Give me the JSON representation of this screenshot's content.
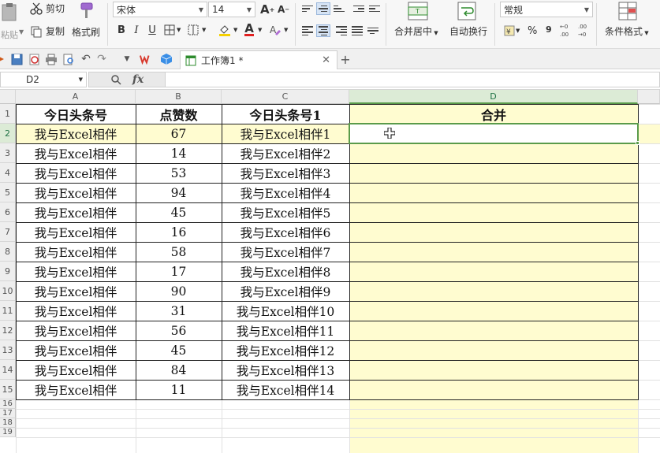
{
  "ribbon": {
    "paste": "粘贴",
    "cut": "剪切",
    "copy": "复制",
    "format_painter": "格式刷",
    "font_name": "宋体",
    "font_size": "14",
    "merge_center": "合并居中",
    "wrap_text": "自动换行",
    "number_format": "常规",
    "percent": "%",
    "thousands": "9",
    "conditional_format": "条件格式",
    "bold": "B",
    "italic": "I",
    "underline": "U"
  },
  "quick_access": {
    "doc_tab": "工作簿1 *"
  },
  "formula_bar": {
    "cell_ref": "D2",
    "fx_label": "fx",
    "value": ""
  },
  "grid": {
    "columns": [
      "A",
      "B",
      "C",
      "D"
    ],
    "row_numbers": [
      "1",
      "2",
      "3",
      "4",
      "5",
      "6",
      "7",
      "8",
      "9",
      "10",
      "11",
      "12",
      "13",
      "14",
      "15",
      "16",
      "17",
      "18",
      "19"
    ],
    "headers": [
      "今日头条号",
      "点赞数",
      "今日头条号1",
      "合并"
    ],
    "rows": [
      [
        "我与Excel相伴",
        "67",
        "我与Excel相伴1",
        ""
      ],
      [
        "我与Excel相伴",
        "14",
        "我与Excel相伴2",
        ""
      ],
      [
        "我与Excel相伴",
        "53",
        "我与Excel相伴3",
        ""
      ],
      [
        "我与Excel相伴",
        "94",
        "我与Excel相伴4",
        ""
      ],
      [
        "我与Excel相伴",
        "45",
        "我与Excel相伴5",
        ""
      ],
      [
        "我与Excel相伴",
        "16",
        "我与Excel相伴6",
        ""
      ],
      [
        "我与Excel相伴",
        "58",
        "我与Excel相伴7",
        ""
      ],
      [
        "我与Excel相伴",
        "17",
        "我与Excel相伴8",
        ""
      ],
      [
        "我与Excel相伴",
        "90",
        "我与Excel相伴9",
        ""
      ],
      [
        "我与Excel相伴",
        "31",
        "我与Excel相伴10",
        ""
      ],
      [
        "我与Excel相伴",
        "56",
        "我与Excel相伴11",
        ""
      ],
      [
        "我与Excel相伴",
        "45",
        "我与Excel相伴12",
        ""
      ],
      [
        "我与Excel相伴",
        "84",
        "我与Excel相伴13",
        ""
      ],
      [
        "我与Excel相伴",
        "11",
        "我与Excel相伴14",
        ""
      ]
    ],
    "selected_cell": "D2",
    "selected_column": "D"
  },
  "colors": {
    "selection_fill": "#fffcd0",
    "row_highlight": "#fffcd0",
    "selection_border": "#5a9b4a",
    "header_selected": "#dcebd6"
  },
  "icons": [
    "paste-icon",
    "scissors-icon",
    "copy-icon",
    "format-painter-icon",
    "font-grow-icon",
    "font-shrink-icon",
    "border-icon",
    "fill-color-icon",
    "font-color-icon",
    "clear-icon",
    "align-top-icon",
    "align-middle-icon",
    "align-bottom-icon",
    "indent-icon",
    "merge-center-icon",
    "wrap-text-icon",
    "currency-icon",
    "decimal-increase-icon",
    "decimal-decrease-icon",
    "conditional-format-icon",
    "save-icon",
    "pdf-icon",
    "print-icon",
    "print-preview-icon",
    "undo-icon",
    "redo-icon",
    "wps-logo-icon",
    "cloud-box-icon",
    "sheet-icon",
    "close-tab-icon",
    "new-tab-icon",
    "zoom-icon",
    "cross-cursor-icon"
  ]
}
